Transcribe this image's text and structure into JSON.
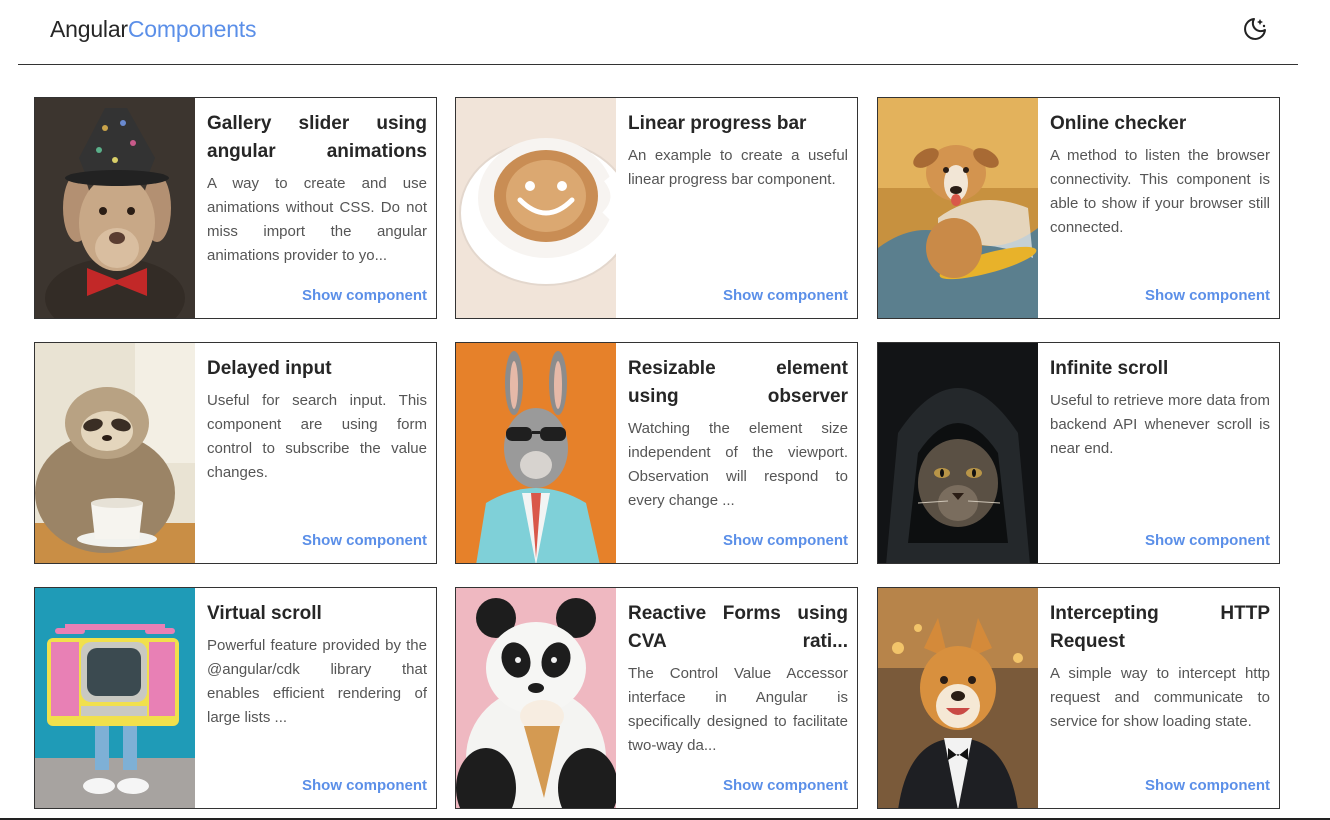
{
  "header": {
    "brand_part1": "Angular",
    "brand_part2": "Components",
    "theme_icon": "moon-stars-icon",
    "brand_color": "#5b8fe8"
  },
  "link_label": "Show component",
  "cards": [
    {
      "title": "Gallery slider using angular animations",
      "description": "A way to create and use animations without CSS. Do not miss import the angular animations provider to yo...",
      "link": "Show component",
      "image": "dog-with-hat-image"
    },
    {
      "title": "Linear progress bar",
      "description": "An example to create a useful linear progress bar component.",
      "link": "Show component",
      "image": "coffee-smiley-image"
    },
    {
      "title": "Online checker",
      "description": "A method to listen the browser connectivity. This component is able to show if your browser still connected.",
      "link": "Show component",
      "image": "surfing-dog-image"
    },
    {
      "title": "Delayed input",
      "description": "Useful for search input. This component are using form control to subscribe the value changes.",
      "link": "Show component",
      "image": "sloth-coffee-image"
    },
    {
      "title": "Resizable element using observer",
      "description": "Watching the element size independent of the viewport. Observation will respond to every change ...",
      "link": "Show component",
      "image": "rabbit-suit-image"
    },
    {
      "title": "Infinite scroll",
      "description": "Useful to retrieve more data from backend API whenever scroll is near end.",
      "link": "Show component",
      "image": "hooded-cat-image"
    },
    {
      "title": "Virtual scroll",
      "description": "Powerful feature provided by the @angular/cdk library that enables efficient rendering of large lists ...",
      "link": "Show component",
      "image": "tv-robot-image"
    },
    {
      "title": "Reactive Forms using CVA rati...",
      "description": "The Control Value Accessor interface in Angular is specifically designed to facilitate two-way da...",
      "link": "Show component",
      "image": "panda-icecream-image"
    },
    {
      "title": "Intercepting HTTP Request",
      "description": "A simple way to intercept http request and communicate to service for show loading state.",
      "link": "Show component",
      "image": "shiba-tuxedo-image"
    }
  ]
}
